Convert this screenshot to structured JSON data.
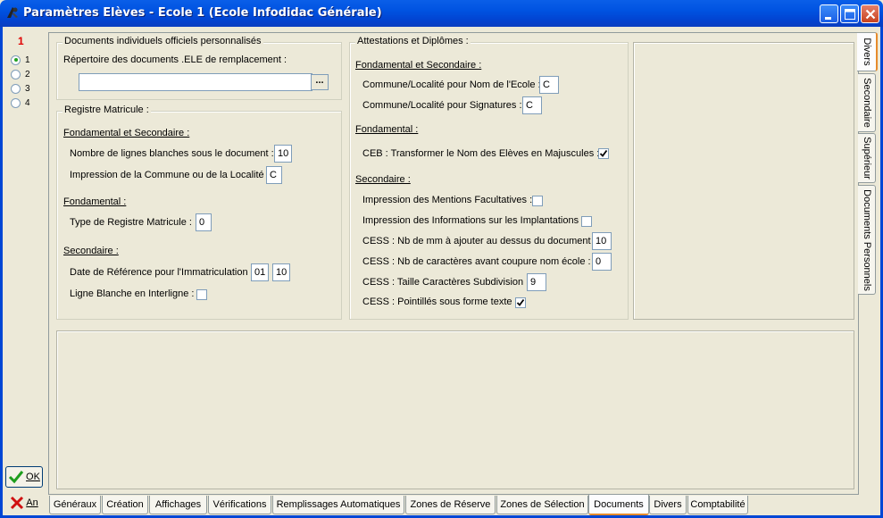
{
  "window": {
    "title": "Paramètres Elèves - Ecole 1 (Ecole Infodidac Générale)"
  },
  "left_strip": {
    "number": "1",
    "radios": [
      {
        "label": "1",
        "checked": true
      },
      {
        "label": "2",
        "checked": false
      },
      {
        "label": "3",
        "checked": false
      },
      {
        "label": "4",
        "checked": false
      }
    ],
    "ok_label": "OK",
    "cancel_label": "An"
  },
  "documents_group": {
    "title": "Documents individuels officiels personnalisés",
    "repertoire_label": "Répertoire des documents .ELE de remplacement :",
    "repertoire_value": "",
    "browse_label": "..."
  },
  "registre_group": {
    "title": "Registre Matricule :",
    "section1": "Fondamental et Secondaire :",
    "lignes_label": "Nombre de lignes blanches sous le document :",
    "lignes_value": "10",
    "commune_label": "Impression de la Commune ou de la Localité :",
    "commune_value": "C",
    "section2": "Fondamental :",
    "type_label": "Type de Registre Matricule :",
    "type_value": "0",
    "section3": "Secondaire :",
    "date_label": "Date de Référence pour l'Immatriculation :",
    "date_day": "01",
    "date_month": "10",
    "interligne_label": "Ligne Blanche en Interligne :",
    "interligne_checked": false
  },
  "attestations_group": {
    "title": "Attestations et Diplômes :",
    "section1": "Fondamental et Secondaire :",
    "nom_ecole_label": "Commune/Localité pour Nom de l'Ecole :",
    "nom_ecole_value": "C",
    "signatures_label": "Commune/Localité pour Signatures :",
    "signatures_value": "C",
    "section2": "Fondamental :",
    "ceb_label": "CEB :  Transformer le Nom des Elèves en Majuscules :",
    "ceb_checked": true,
    "section3": "Secondaire :",
    "mentions_label": "Impression des Mentions Facultatives :",
    "mentions_checked": false,
    "implantations_label": "Impression des Informations sur les Implantations :",
    "implantations_checked": false,
    "cess_mm_label": "CESS : Nb de mm à ajouter au dessus du document :",
    "cess_mm_value": "10",
    "cess_car_label": "CESS : Nb de caractères avant coupure nom école :",
    "cess_car_value": "0",
    "cess_taille_label": "CESS : Taille Caractères Subdivision :",
    "cess_taille_value": "9",
    "cess_pointilles_label": "CESS : Pointillés sous forme texte :",
    "cess_pointilles_checked": true
  },
  "right_tabs": [
    "Divers",
    "Secondaire",
    "Supérieur",
    "Documents Personnels"
  ],
  "right_tabs_active": "Divers",
  "bottom_tabs": [
    "Généraux",
    "Création",
    "Affichages",
    "Vérifications",
    "Remplissages Automatiques",
    "Zones de Réserve",
    "Zones de Sélection",
    "Documents",
    "Divers",
    "Comptabilité"
  ],
  "bottom_tabs_active": "Documents",
  "colors": {
    "titlebar": "#0053E1",
    "face": "#ECE9D8",
    "accent_tab": "#E68B2C",
    "number": "#E00000"
  }
}
